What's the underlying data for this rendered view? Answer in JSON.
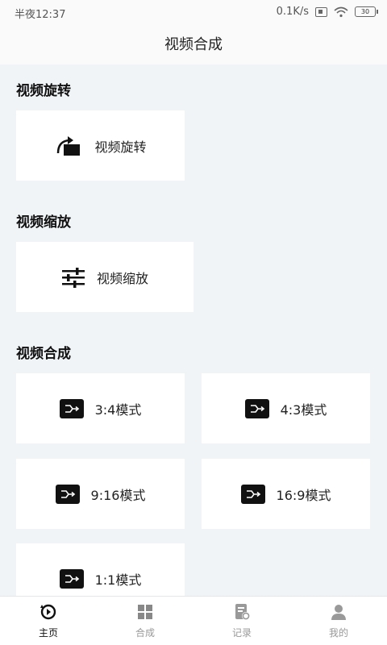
{
  "status_bar": {
    "time": "半夜12:37",
    "speed": "0.1K/s",
    "battery": "30"
  },
  "header": {
    "title": "视频合成"
  },
  "sections": {
    "rotate": {
      "title": "视频旋转",
      "card_label": "视频旋转"
    },
    "scale": {
      "title": "视频缩放",
      "card_label": "视频缩放"
    },
    "merge": {
      "title": "视频合成",
      "modes": [
        "3:4模式",
        "4:3模式",
        "9:16模式",
        "16:9模式",
        "1:1模式"
      ]
    }
  },
  "tabs": [
    {
      "label": "主页",
      "icon": "home-icon",
      "active": true
    },
    {
      "label": "合成",
      "icon": "grid-icon",
      "active": false
    },
    {
      "label": "记录",
      "icon": "record-icon",
      "active": false
    },
    {
      "label": "我的",
      "icon": "profile-icon",
      "active": false
    }
  ]
}
